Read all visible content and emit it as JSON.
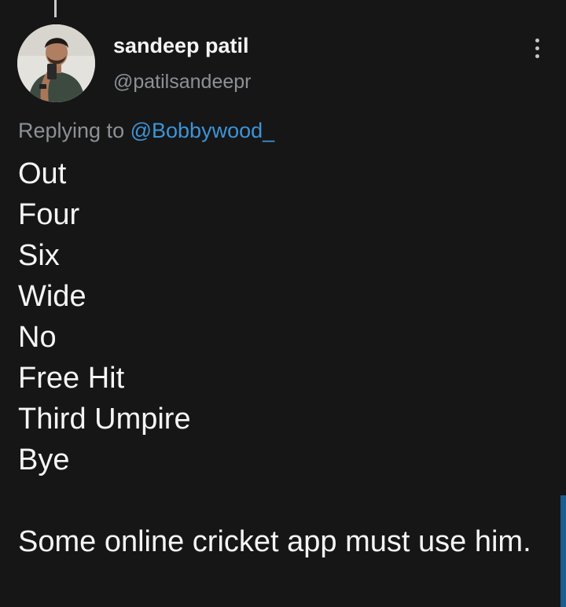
{
  "author": {
    "display_name": "sandeep patil",
    "handle": "@patilsandeepr",
    "avatar": "profile-photo"
  },
  "reply_context": {
    "prefix": "Replying to",
    "mention": "@Bobbywood_"
  },
  "tweet": {
    "lines": [
      "Out",
      "Four",
      "Six",
      "Wide",
      "No",
      "Free Hit",
      "Third Umpire",
      "Bye"
    ],
    "closing": "Some online cricket app must use him."
  },
  "icons": {
    "more": "vertical-ellipsis-icon"
  },
  "colors": {
    "background": "#161616",
    "text": "#f5f5f5",
    "muted": "#8d9196",
    "link": "#3d94d8"
  }
}
